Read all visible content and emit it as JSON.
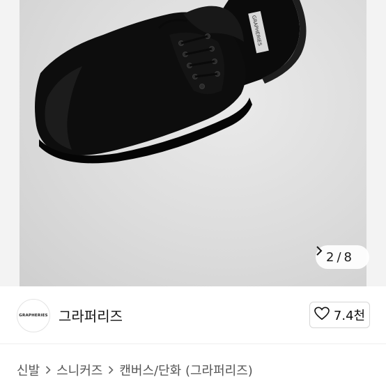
{
  "gallery": {
    "current_page": "2",
    "separator": "/",
    "total_pages": "8",
    "next_icon": "chevron-right-icon",
    "shoe_label_text": "GRAPHERIES"
  },
  "shop": {
    "logo_text": "GRAPHERIES",
    "name": "그라퍼리즈",
    "like_icon": "heart-outline-icon",
    "like_count": "7.4천"
  },
  "breadcrumb": {
    "items": [
      "신발",
      "스니커즈",
      "캔버스/단화 (그라퍼리즈)"
    ],
    "separator_icon": "chevron-right-icon"
  },
  "colors": {
    "gallery_bg": "#ececec",
    "shoe": "#0d0d0d",
    "text_primary": "#111111",
    "text_secondary": "#555555",
    "border": "#d6d6d6"
  }
}
